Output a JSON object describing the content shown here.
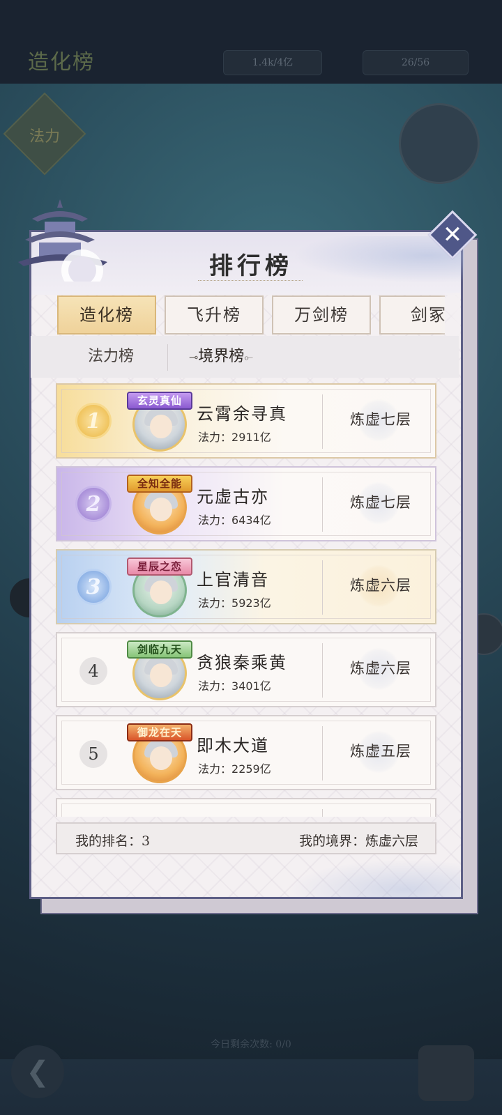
{
  "background": {
    "title": "造化榜",
    "resource_1": "1.4k/4亿",
    "resource_2": "26/56",
    "diamond_label": "法力",
    "bottom_text": "今日剩余次数: 0/0"
  },
  "panel": {
    "title": "排行榜",
    "tabs": [
      {
        "label": "造化榜",
        "active": true
      },
      {
        "label": "飞升榜",
        "active": false
      },
      {
        "label": "万剑榜",
        "active": false
      },
      {
        "label": "剑冢",
        "active": false
      }
    ],
    "subtabs": [
      {
        "label": "法力榜",
        "active": false
      },
      {
        "label": "境界榜",
        "active": true
      }
    ],
    "power_label": "法力：",
    "rows": [
      {
        "rank": "1",
        "title_badge": "玄灵真仙",
        "name": "云霄余寻真",
        "power": "2911亿",
        "realm": "炼虚七层"
      },
      {
        "rank": "2",
        "title_badge": "全知全能",
        "name": "元虚古亦",
        "power": "6434亿",
        "realm": "炼虚七层"
      },
      {
        "rank": "3",
        "title_badge": "星辰之恋",
        "name": "上官清音",
        "power": "5923亿",
        "realm": "炼虚六层"
      },
      {
        "rank": "4",
        "title_badge": "剑临九天",
        "name": "贪狼秦乘黄",
        "power": "3401亿",
        "realm": "炼虚六层"
      },
      {
        "rank": "5",
        "title_badge": "御龙在天",
        "name": "即木大道",
        "power": "2259亿",
        "realm": "炼虚五层"
      }
    ],
    "footer": {
      "my_rank": "我的排名：3",
      "my_realm": "我的境界：炼虚六层"
    },
    "colors": {
      "frame": "#5d5f86",
      "gold": "#f0c45e",
      "purple": "#a98fd9",
      "blue": "#8fb3e6",
      "active_tab": "#efd29a"
    }
  }
}
